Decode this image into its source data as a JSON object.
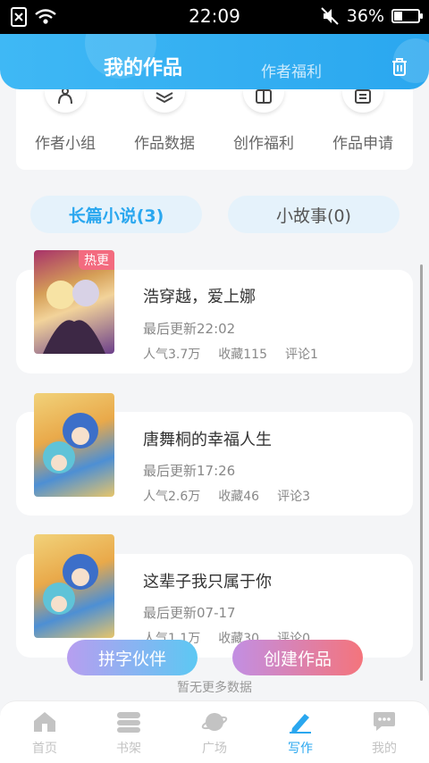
{
  "status_bar": {
    "time": "22:09",
    "battery": "36%",
    "battery_level": 0.36
  },
  "header": {
    "title": "我的作品",
    "secondary_tab": "作者福利"
  },
  "quick_actions": [
    {
      "label": "作者小组",
      "icon": "group-icon"
    },
    {
      "label": "作品数据",
      "icon": "layers-icon"
    },
    {
      "label": "创作福利",
      "icon": "gift-icon"
    },
    {
      "label": "作品申请",
      "icon": "document-icon"
    }
  ],
  "segments": {
    "long": "长篇小说(3)",
    "short": "小故事(0)"
  },
  "works": [
    {
      "title": "浩穿越，爱上娜",
      "update": "最后更新22:02",
      "popularity": "人气3.7万",
      "favorites": "收藏115",
      "comments": "评论1",
      "tag": "热更"
    },
    {
      "title": "唐舞桐的幸福人生",
      "update": "最后更新17:26",
      "popularity": "人气2.6万",
      "favorites": "收藏46",
      "comments": "评论3"
    },
    {
      "title": "这辈子我只属于你",
      "update": "最后更新07-17",
      "popularity": "人气1.1万",
      "favorites": "收藏30",
      "comments": "评论0"
    }
  ],
  "actions": {
    "partner": "拼字伙伴",
    "create": "创建作品"
  },
  "footer_note": "暂无更多数据",
  "tabs": [
    "首页",
    "书架",
    "广场",
    "写作",
    "我的"
  ],
  "colors": {
    "accent": "#2aa7ef",
    "hot_tag": "#f36b7f"
  }
}
